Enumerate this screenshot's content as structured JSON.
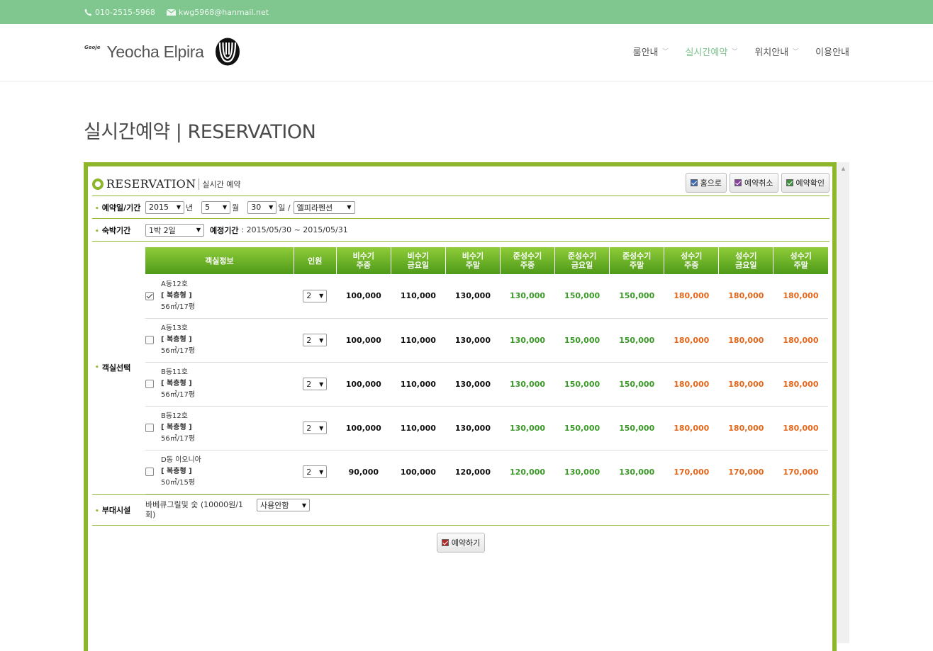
{
  "topbar": {
    "phone": "010-2515-5968",
    "email": "kwg5968@hanmail.net"
  },
  "header": {
    "logo_small": "Geoje",
    "logo_name": "Yeocha Elpira",
    "nav": [
      {
        "label": "룸안내",
        "chevron": true,
        "active": false
      },
      {
        "label": "실시간예약",
        "chevron": true,
        "active": true
      },
      {
        "label": "위치안내",
        "chevron": true,
        "active": false
      },
      {
        "label": "이용안내",
        "chevron": false,
        "active": false
      }
    ]
  },
  "page_title": "실시간예약 | RESERVATION",
  "reservation": {
    "logo_big": "RESERVATION",
    "logo_sub": "실시간 예약",
    "buttons": {
      "home": "홈으로",
      "cancel": "예약취소",
      "confirm": "예약확인"
    },
    "date_row": {
      "label": "예약일/기간",
      "year": "2015",
      "year_unit": "년",
      "month": "5",
      "month_unit": "월",
      "day": "30",
      "day_unit": "일 /",
      "pension": "엘피라펜션"
    },
    "stay_row": {
      "label": "숙박기간",
      "stay": "1박 2일",
      "period_label": "예정기간",
      "period_value": ": 2015/05/30 ~ 2015/05/31"
    },
    "room_label": "객실선택",
    "table_headers": [
      [
        "객실정보"
      ],
      [
        "인원"
      ],
      [
        "비수기",
        "주중"
      ],
      [
        "비수기",
        "금요일"
      ],
      [
        "비수기",
        "주말"
      ],
      [
        "준성수기",
        "주중"
      ],
      [
        "준성수기",
        "금요일"
      ],
      [
        "준성수기",
        "주말"
      ],
      [
        "성수기",
        "주중"
      ],
      [
        "성수기",
        "금요일"
      ],
      [
        "성수기",
        "주말"
      ]
    ],
    "rooms": [
      {
        "name": "A동12호",
        "type": "[ 복층형 ]",
        "size": "56㎡/17평",
        "checked": true,
        "people": "2",
        "prices": [
          "100,000",
          "110,000",
          "130,000",
          "130,000",
          "150,000",
          "150,000",
          "180,000",
          "180,000",
          "180,000"
        ]
      },
      {
        "name": "A동13호",
        "type": "[ 복층형 ]",
        "size": "56㎡/17평",
        "checked": false,
        "people": "2",
        "prices": [
          "100,000",
          "110,000",
          "130,000",
          "130,000",
          "150,000",
          "150,000",
          "180,000",
          "180,000",
          "180,000"
        ]
      },
      {
        "name": "B동11호",
        "type": "[ 복층형 ]",
        "size": "56㎡/17평",
        "checked": false,
        "people": "2",
        "prices": [
          "100,000",
          "110,000",
          "130,000",
          "130,000",
          "150,000",
          "150,000",
          "180,000",
          "180,000",
          "180,000"
        ]
      },
      {
        "name": "B동12호",
        "type": "[ 복층형 ]",
        "size": "56㎡/17평",
        "checked": false,
        "people": "2",
        "prices": [
          "100,000",
          "110,000",
          "130,000",
          "130,000",
          "150,000",
          "150,000",
          "180,000",
          "180,000",
          "180,000"
        ]
      },
      {
        "name": "D동 이오니아",
        "type": "[ 복층형 ]",
        "size": "50㎡/15평",
        "checked": false,
        "people": "2",
        "prices": [
          "90,000",
          "100,000",
          "120,000",
          "120,000",
          "130,000",
          "130,000",
          "170,000",
          "170,000",
          "170,000"
        ]
      }
    ],
    "extra_row": {
      "label": "부대시설",
      "text": "바베큐그릴및 숯 (10000원/1회)",
      "select": "사용안함"
    },
    "submit": "예약하기"
  },
  "colors": {
    "topbar": "#7fc68f",
    "frame": "#8db62a",
    "nav_active": "#7cc48c",
    "green_price": "#3b9a28",
    "orange_price": "#e3671a"
  }
}
